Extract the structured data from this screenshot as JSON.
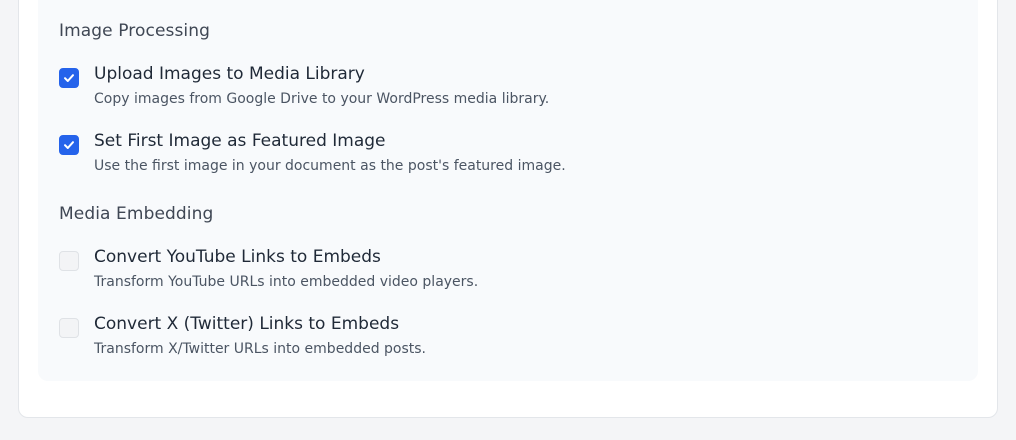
{
  "sections": [
    {
      "heading": "Image Processing",
      "options": [
        {
          "title": "Upload Images to Media Library",
          "description": "Copy images from Google Drive to your WordPress media library.",
          "checked": true
        },
        {
          "title": "Set First Image as Featured Image",
          "description": "Use the first image in your document as the post's featured image.",
          "checked": true
        }
      ]
    },
    {
      "heading": "Media Embedding",
      "options": [
        {
          "title": "Convert YouTube Links to Embeds",
          "description": "Transform YouTube URLs into embedded video players.",
          "checked": false
        },
        {
          "title": "Convert X (Twitter) Links to Embeds",
          "description": "Transform X/Twitter URLs into embedded posts.",
          "checked": false
        }
      ]
    }
  ],
  "colors": {
    "accent": "#2563eb",
    "unchecked_fill": "#f3f4f6"
  },
  "icons": {
    "checked": "check-icon"
  }
}
